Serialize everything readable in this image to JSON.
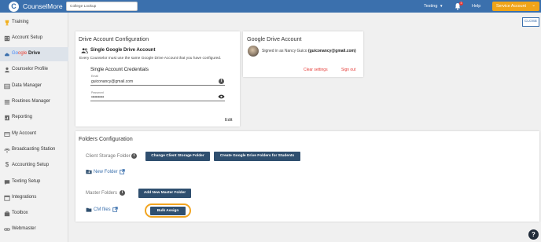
{
  "header": {
    "brand": "CounselMore",
    "search_value": "College Lookup",
    "env_label": "Testing",
    "notification_count": "3",
    "help_label": "Help",
    "account_button": "Service Account"
  },
  "sidebar": {
    "items": [
      {
        "label": "Training",
        "icon": "trophy-icon"
      },
      {
        "label": "Account Setup",
        "icon": "building-icon"
      },
      {
        "label": "Google Drive",
        "label_prefix": "Go",
        "label_mid": "ogle",
        "label_suffix": " Drive",
        "icon": "cloud-icon"
      },
      {
        "label": "Counselor Profile",
        "icon": "person-icon"
      },
      {
        "label": "Data Manager",
        "icon": "database-icon"
      },
      {
        "label": "Routines Manager",
        "icon": "list-icon"
      },
      {
        "label": "Reporting",
        "icon": "report-icon"
      },
      {
        "label": "My Account",
        "icon": "card-icon"
      },
      {
        "label": "Broadcasting Station",
        "icon": "broadcast-icon"
      },
      {
        "label": "Accounting Setup",
        "icon": "dollar-icon"
      },
      {
        "label": "Texting Setup",
        "icon": "chat-icon"
      },
      {
        "label": "Integrations",
        "icon": "calendar-icon"
      },
      {
        "label": "Toolbox",
        "icon": "toolbox-icon"
      },
      {
        "label": "Webmaster",
        "icon": "link-icon"
      }
    ]
  },
  "close_label": "CLOSE",
  "drive_config": {
    "title": "Drive Account Configuration",
    "subtitle": "Single Google Drive Account",
    "note": "Every Counselor must use the same Google Drive Account that you have configured.",
    "creds_title": "Single Account Credentials",
    "email_label": "Email",
    "email_value": "guiconancy@gmail.com",
    "password_label": "Password",
    "password_value": "•••••••••••",
    "edit_label": "Edit"
  },
  "gdrive_account": {
    "title": "Google Drive Account",
    "signed_prefix": "Signed in as Nancy Guico",
    "signed_email": "(guiconancy@gmail.com)",
    "clear_label": "Clear settings",
    "signout_label": "Sign out"
  },
  "folders": {
    "title": "Folders Configuration",
    "client_storage_label": "Client Storage Folder",
    "change_btn": "Change Client Storage Folder",
    "create_btn": "Create Google Drive Folders for Students",
    "new_folder_label": "New Folder",
    "master_label": "Master Folders",
    "add_master_btn": "Add New Master Folder",
    "cm_files_label": "CM files",
    "bulk_btn": "Bulk Assign"
  },
  "colors": {
    "header_blue": "#3b70ad",
    "accent_orange": "#f0a419",
    "button_navy": "#2f4f6f",
    "danger_red": "#e53935"
  }
}
